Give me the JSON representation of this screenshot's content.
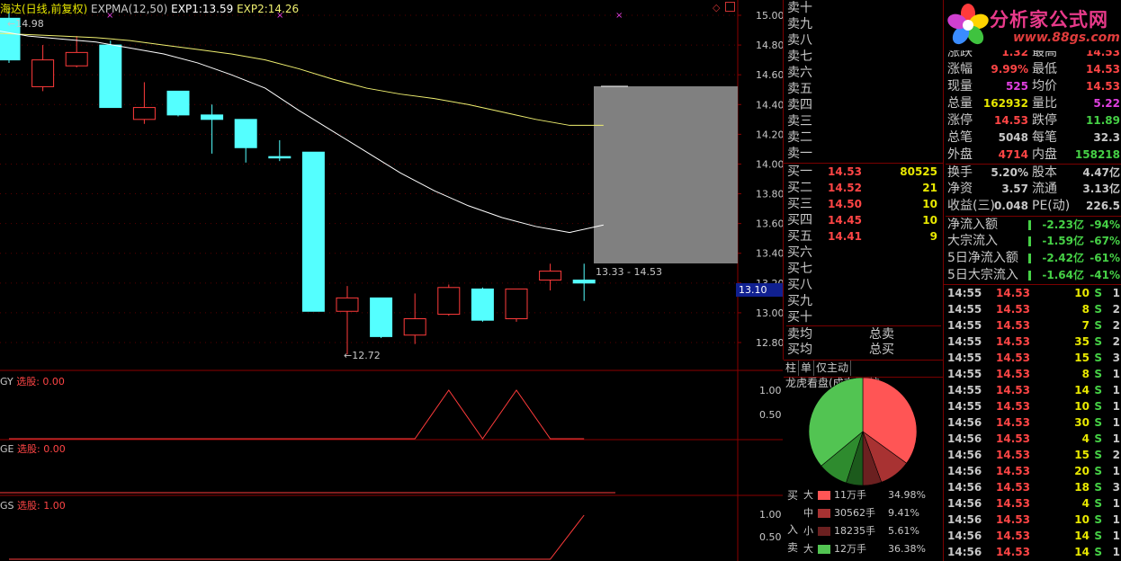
{
  "chart": {
    "legend": {
      "title": "海达(日线,前复权)",
      "indicator": "EXPMA(12,50)",
      "exp1_label": "EXP1:",
      "exp1_value": "13.59",
      "exp2_label": "EXP2:",
      "exp2_value": "14.26"
    },
    "high_label": "14.98",
    "low_label": "12.72",
    "range_label": "13.33 - 14.53",
    "current_price_tag": "13.10",
    "price_axis": [
      "15.00",
      "14.80",
      "14.60",
      "14.40",
      "14.20",
      "14.00",
      "13.80",
      "13.60",
      "13.40",
      "13.20",
      "13.00",
      "12.80"
    ],
    "panels": [
      {
        "label": "GY",
        "sel_label": "选股:",
        "sel_value": "0.00",
        "ticks": [
          "1.00",
          "0.50"
        ]
      },
      {
        "label": "GE",
        "sel_label": "选股:",
        "sel_value": "0.00",
        "ticks": []
      },
      {
        "label": "GS",
        "sel_label": "选股:",
        "sel_value": "1.00",
        "ticks": [
          "1.00",
          "0.50"
        ]
      }
    ],
    "colors": {
      "up": "#ff3b3b",
      "down": "#54ffff",
      "exp1": "#ffffff",
      "exp2": "#f0f070",
      "grid": "#8b0000"
    }
  },
  "chart_data": {
    "type": "candlestick",
    "ylim": [
      12.6,
      15.05
    ],
    "candles": [
      {
        "o": 14.98,
        "h": 15.05,
        "l": 14.68,
        "c": 14.7
      },
      {
        "o": 14.52,
        "h": 14.8,
        "l": 14.49,
        "c": 14.7
      },
      {
        "o": 14.66,
        "h": 14.86,
        "l": 14.65,
        "c": 14.75
      },
      {
        "o": 14.8,
        "h": 14.83,
        "l": 14.38,
        "c": 14.38
      },
      {
        "o": 14.3,
        "h": 14.55,
        "l": 14.27,
        "c": 14.38
      },
      {
        "o": 14.49,
        "h": 14.49,
        "l": 14.32,
        "c": 14.33
      },
      {
        "o": 14.33,
        "h": 14.4,
        "l": 14.07,
        "c": 14.3
      },
      {
        "o": 14.3,
        "h": 14.3,
        "l": 14.01,
        "c": 14.11
      },
      {
        "o": 14.05,
        "h": 14.16,
        "l": 14.02,
        "c": 14.05
      },
      {
        "o": 14.08,
        "h": 14.08,
        "l": 13.01,
        "c": 13.01
      },
      {
        "o": 13.01,
        "h": 13.18,
        "l": 12.72,
        "c": 13.1
      },
      {
        "o": 13.1,
        "h": 13.1,
        "l": 12.83,
        "c": 12.84
      },
      {
        "o": 12.85,
        "h": 13.13,
        "l": 12.79,
        "c": 12.96
      },
      {
        "o": 12.99,
        "h": 13.19,
        "l": 12.98,
        "c": 13.17
      },
      {
        "o": 13.16,
        "h": 13.17,
        "l": 12.94,
        "c": 12.95
      },
      {
        "o": 12.96,
        "h": 13.15,
        "l": 12.94,
        "c": 13.16
      },
      {
        "o": 13.22,
        "h": 13.33,
        "l": 13.15,
        "c": 13.28
      },
      {
        "o": 13.22,
        "h": 13.33,
        "l": 13.08,
        "c": 13.2
      }
    ],
    "exp1": [
      14.9,
      14.86,
      14.84,
      14.82,
      14.78,
      14.74,
      14.68,
      14.6,
      14.51,
      14.36,
      14.22,
      14.08,
      13.94,
      13.82,
      13.72,
      13.64,
      13.58,
      13.54,
      13.59
    ],
    "exp2": [
      14.88,
      14.87,
      14.86,
      14.85,
      14.83,
      14.8,
      14.77,
      14.74,
      14.7,
      14.64,
      14.57,
      14.51,
      14.47,
      14.44,
      14.4,
      14.35,
      14.3,
      14.26,
      14.26
    ],
    "gy": [
      0,
      0,
      0,
      0,
      0,
      0,
      0,
      0,
      0,
      0,
      0,
      0,
      0,
      1,
      0,
      1,
      0,
      0
    ],
    "gs": [
      0,
      0,
      0,
      0,
      0,
      0,
      0,
      0,
      0,
      0,
      0,
      0,
      0,
      0,
      0,
      0,
      0,
      1
    ]
  },
  "book": {
    "sells": [
      "卖十",
      "卖九",
      "卖八",
      "卖七",
      "卖六",
      "卖五",
      "卖四",
      "卖三",
      "卖二",
      "卖一"
    ],
    "buys": [
      {
        "label": "买一",
        "price": "14.53",
        "vol": "80525"
      },
      {
        "label": "买二",
        "price": "14.52",
        "vol": "21"
      },
      {
        "label": "买三",
        "price": "14.50",
        "vol": "10"
      },
      {
        "label": "买四",
        "price": "14.45",
        "vol": "10"
      },
      {
        "label": "买五",
        "price": "14.41",
        "vol": "9"
      },
      {
        "label": "买六",
        "price": "",
        "vol": ""
      },
      {
        "label": "买七",
        "price": "",
        "vol": ""
      },
      {
        "label": "买八",
        "price": "",
        "vol": ""
      },
      {
        "label": "买九",
        "price": "",
        "vol": ""
      },
      {
        "label": "买十",
        "price": "",
        "vol": ""
      }
    ],
    "avg_sell": "卖均",
    "avg_buy": "买均",
    "total_sell": "总卖",
    "total_buy": "总买"
  },
  "tabs": [
    "柱",
    "单",
    "仅主动",
    "龙虎看盘(成交量/按"
  ],
  "pie": {
    "slices": [
      {
        "pct": 34.98,
        "color": "#ff5555"
      },
      {
        "pct": 9.41,
        "color": "#a83232"
      },
      {
        "pct": 5.61,
        "color": "#6b2020"
      },
      {
        "pct": 5.0,
        "color": "#1c5a1c"
      },
      {
        "pct": 9.0,
        "color": "#2e8b2e"
      },
      {
        "pct": 36.0,
        "color": "#52c452"
      }
    ]
  },
  "flow_legend": {
    "buy_label": "买",
    "in_label": "入",
    "sell_label": "卖",
    "rows": [
      {
        "size": "大",
        "amount": "11万手",
        "pct": "34.98%",
        "color": "#ff5555"
      },
      {
        "size": "中",
        "amount": "30562手",
        "pct": "9.41%",
        "color": "#a83232"
      },
      {
        "size": "小",
        "amount": "18235手",
        "pct": "5.61%",
        "color": "#6b2020"
      },
      {
        "size": "大",
        "amount": "12万手",
        "pct": "36.38%",
        "color": "#52c452"
      }
    ]
  },
  "logo": {
    "title": "分析家公式网",
    "url": "www.88gs.com"
  },
  "quote": {
    "rows": [
      {
        "l1": "涨跌",
        "v1": "1.32",
        "c1": "red",
        "l2": "最高",
        "v2": "14.53",
        "c2": "red"
      },
      {
        "l1": "涨幅",
        "v1": "9.99%",
        "c1": "red",
        "l2": "最低",
        "v2": "14.53",
        "c2": "red"
      },
      {
        "l1": "现量",
        "v1": "525",
        "c1": "mag",
        "l2": "均价",
        "v2": "14.53",
        "c2": "red"
      },
      {
        "l1": "总量",
        "v1": "162932",
        "c1": "yel",
        "l2": "量比",
        "v2": "5.22",
        "c2": "mag"
      },
      {
        "l1": "涨停",
        "v1": "14.53",
        "c1": "red",
        "l2": "跌停",
        "v2": "11.89",
        "c2": "grn"
      },
      {
        "l1": "总笔",
        "v1": "5048",
        "c1": "wht",
        "l2": "每笔",
        "v2": "32.3",
        "c2": "wht"
      },
      {
        "l1": "外盘",
        "v1": "4714",
        "c1": "red",
        "l2": "内盘",
        "v2": "158218",
        "c2": "grn"
      },
      {
        "l1": "换手",
        "v1": "5.20%",
        "c1": "wht",
        "l2": "股本",
        "v2": "4.47亿",
        "c2": "wht"
      },
      {
        "l1": "净资",
        "v1": "3.57",
        "c1": "wht",
        "l2": "流通",
        "v2": "3.13亿",
        "c2": "wht"
      },
      {
        "l1": "收益(三)",
        "v1": "0.048",
        "c1": "wht",
        "l2": "PE(动)",
        "v2": "226.5",
        "c2": "wht"
      }
    ],
    "flows": [
      {
        "label": "净流入额",
        "amount": "-2.23亿",
        "pct": "-94%"
      },
      {
        "label": "大宗流入",
        "amount": "-1.59亿",
        "pct": "-67%"
      },
      {
        "label": "5日净流入额",
        "amount": "-2.42亿",
        "pct": "-61%"
      },
      {
        "label": "5日大宗流入",
        "amount": "-1.64亿",
        "pct": "-41%"
      }
    ],
    "ticks": [
      {
        "t": "14:55",
        "p": "14.53",
        "v": "10",
        "s": "S",
        "n": "1"
      },
      {
        "t": "14:55",
        "p": "14.53",
        "v": "8",
        "s": "S",
        "n": "2"
      },
      {
        "t": "14:55",
        "p": "14.53",
        "v": "7",
        "s": "S",
        "n": "2"
      },
      {
        "t": "14:55",
        "p": "14.53",
        "v": "35",
        "s": "S",
        "n": "2"
      },
      {
        "t": "14:55",
        "p": "14.53",
        "v": "15",
        "s": "S",
        "n": "3"
      },
      {
        "t": "14:55",
        "p": "14.53",
        "v": "8",
        "s": "S",
        "n": "1"
      },
      {
        "t": "14:55",
        "p": "14.53",
        "v": "14",
        "s": "S",
        "n": "1"
      },
      {
        "t": "14:55",
        "p": "14.53",
        "v": "10",
        "s": "S",
        "n": "1"
      },
      {
        "t": "14:56",
        "p": "14.53",
        "v": "30",
        "s": "S",
        "n": "1"
      },
      {
        "t": "14:56",
        "p": "14.53",
        "v": "4",
        "s": "S",
        "n": "1"
      },
      {
        "t": "14:56",
        "p": "14.53",
        "v": "15",
        "s": "S",
        "n": "2"
      },
      {
        "t": "14:56",
        "p": "14.53",
        "v": "20",
        "s": "S",
        "n": "1"
      },
      {
        "t": "14:56",
        "p": "14.53",
        "v": "18",
        "s": "S",
        "n": "3"
      },
      {
        "t": "14:56",
        "p": "14.53",
        "v": "4",
        "s": "S",
        "n": "1"
      },
      {
        "t": "14:56",
        "p": "14.53",
        "v": "10",
        "s": "S",
        "n": "1"
      },
      {
        "t": "14:56",
        "p": "14.53",
        "v": "14",
        "s": "S",
        "n": "1"
      },
      {
        "t": "14:56",
        "p": "14.53",
        "v": "14",
        "s": "S",
        "n": "1"
      }
    ]
  }
}
